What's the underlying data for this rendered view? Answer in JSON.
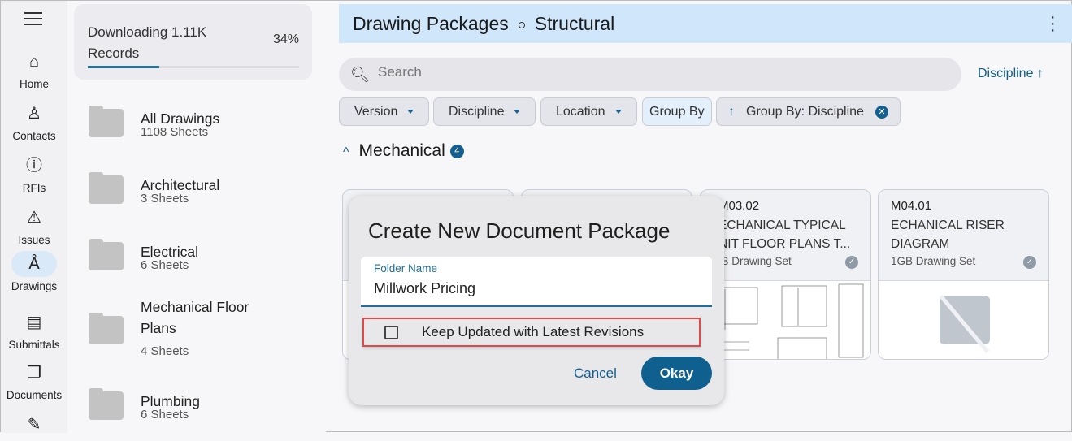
{
  "rail": {
    "items": [
      {
        "label": "Home",
        "icon": "home-icon",
        "glyph": "⌂"
      },
      {
        "label": "Contacts",
        "icon": "person-icon",
        "glyph": "♙"
      },
      {
        "label": "RFIs",
        "icon": "info-icon",
        "glyph": "ⓘ"
      },
      {
        "label": "Issues",
        "icon": "warning-icon",
        "glyph": "⚠"
      },
      {
        "label": "Drawings",
        "icon": "compass-icon",
        "glyph": "Å",
        "active": true
      },
      {
        "label": "Submittals",
        "icon": "document-icon",
        "glyph": "▤"
      },
      {
        "label": "Documents",
        "icon": "folders-icon",
        "glyph": "❐"
      },
      {
        "label": "",
        "icon": "clipboard-icon",
        "glyph": "✎"
      }
    ]
  },
  "download": {
    "text": "Downloading 1.11K Records",
    "percent_label": "34%",
    "progress": 0.34
  },
  "folders": [
    {
      "name": "All Drawings",
      "count": "1108 Sheets"
    },
    {
      "name": "Architectural",
      "count": "3 Sheets"
    },
    {
      "name": "Electrical",
      "count": "6 Sheets"
    },
    {
      "name": "Mechanical Floor Plans",
      "count": "4 Sheets"
    },
    {
      "name": "Plumbing",
      "count": "6 Sheets"
    }
  ],
  "header": {
    "title": "Drawing Packages",
    "subtitle": "Structural"
  },
  "search": {
    "placeholder": "Search"
  },
  "sort": {
    "label": "Discipline ↑"
  },
  "chips": {
    "version": "Version",
    "discipline": "Discipline",
    "location": "Location",
    "group_by": "Group By",
    "active_group": "Group By: Discipline"
  },
  "group": {
    "title": "Mechanical",
    "count": "4"
  },
  "cards": [
    {
      "id": "",
      "title1": "",
      "title2": "",
      "size": ""
    },
    {
      "id": "",
      "title1": "",
      "title2": "",
      "size": ""
    },
    {
      "id": "M03.02",
      "title1": "ECHANICAL TYPICAL",
      "title2": "NIT FLOOR PLANS T...",
      "size": "GB Drawing Set"
    },
    {
      "id": "M04.01",
      "title1": "ECHANICAL RISER",
      "title2": "DIAGRAM",
      "size": "1GB Drawing Set"
    }
  ],
  "dialog": {
    "title": "Create New Document Package",
    "field_label": "Folder Name",
    "field_value": "Millwork Pricing",
    "checkbox_label": "Keep Updated with Latest Revisions",
    "checked": false,
    "cancel": "Cancel",
    "ok": "Okay"
  },
  "colors": {
    "accent": "#0f5f8f",
    "header_bg": "#cfe6fb",
    "highlight": "#e24848"
  }
}
